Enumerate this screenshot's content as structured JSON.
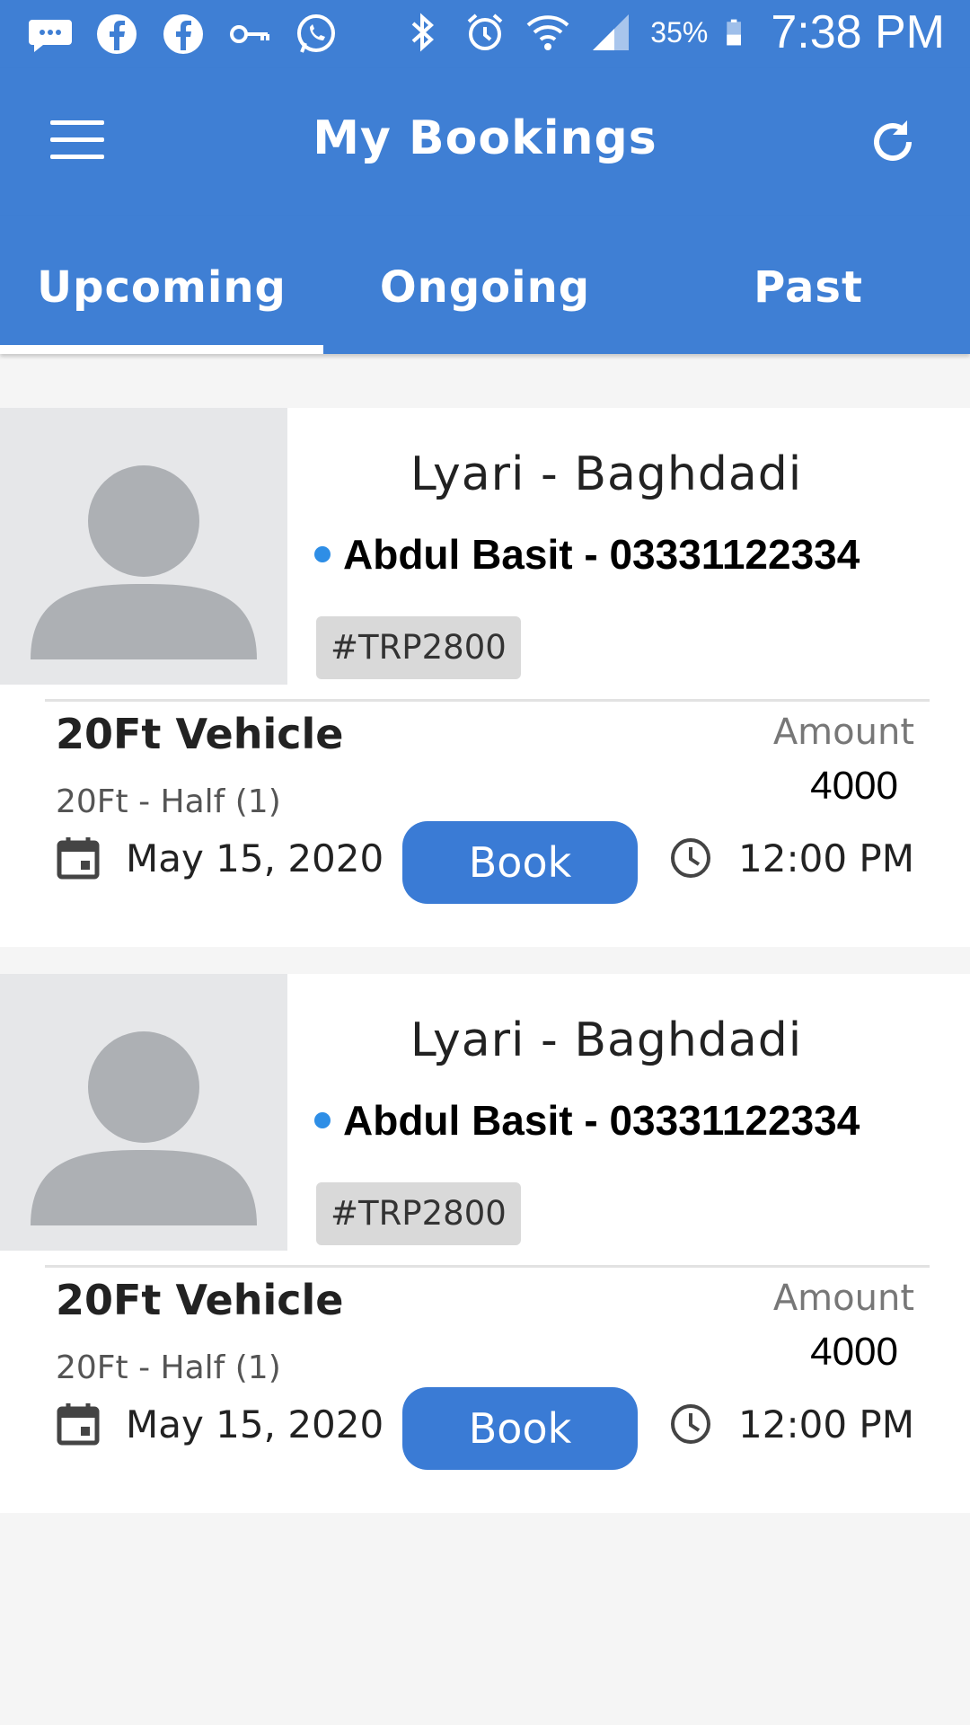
{
  "status_bar": {
    "icons": [
      "chat-bubble-icon",
      "facebook-icon",
      "facebook-icon",
      "key-icon",
      "whatsapp-icon",
      "bluetooth-icon",
      "alarm-icon",
      "wifi-icon",
      "signal-icon",
      "battery-icon"
    ],
    "battery": "35%",
    "time": "7:38 PM"
  },
  "header": {
    "title": "My Bookings",
    "menu_icon": "menu-icon",
    "refresh_icon": "refresh-icon"
  },
  "tabs": [
    {
      "label": "Upcoming",
      "active": true
    },
    {
      "label": "Ongoing",
      "active": false
    },
    {
      "label": "Past",
      "active": false
    }
  ],
  "bookings": [
    {
      "route": "Lyari - Baghdadi",
      "contact": "Abdul Basit - 03331122334",
      "trip_id": "#TRP2800",
      "vehicle": "20Ft Vehicle",
      "vehicle_sub": "20Ft - Half (1)",
      "amount_label": "Amount",
      "amount": "4000",
      "date": "May 15, 2020",
      "book_label": "Book",
      "time": "12:00 PM"
    },
    {
      "route": "Lyari - Baghdadi",
      "contact": "Abdul Basit - 03331122334",
      "trip_id": "#TRP2800",
      "vehicle": "20Ft Vehicle",
      "vehicle_sub": "20Ft - Half (1)",
      "amount_label": "Amount",
      "amount": "4000",
      "date": "May 15, 2020",
      "book_label": "Book",
      "time": "12:00 PM"
    }
  ],
  "colors": {
    "primary": "#3f7fd4",
    "button": "#3a7bd5",
    "dot": "#2e8ee6",
    "background": "#f5f5f5"
  }
}
